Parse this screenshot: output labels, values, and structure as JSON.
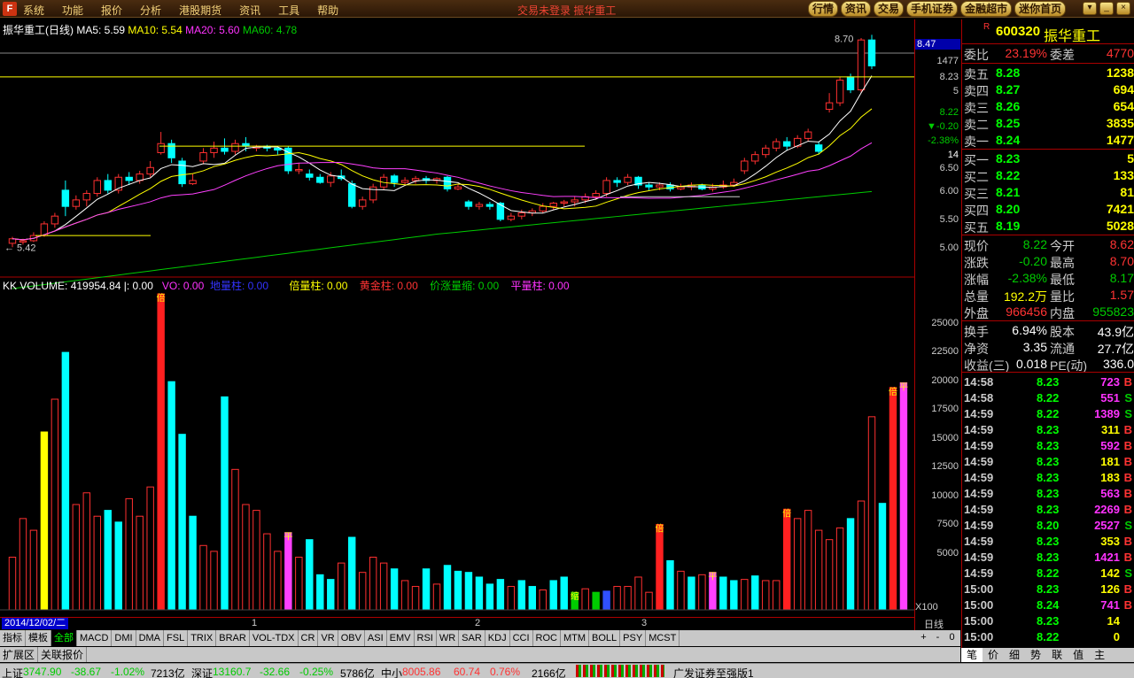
{
  "menu": {
    "items": [
      "系统",
      "功能",
      "报价",
      "分析",
      "港股期货",
      "资讯",
      "工具",
      "帮助"
    ],
    "center_title": "交易未登录    振华重工",
    "top_buttons": [
      "行情",
      "资讯",
      "交易",
      "手机证券",
      "金融超市",
      "迷你首页"
    ],
    "window_buttons": [
      "▾",
      "_",
      "×"
    ]
  },
  "chart": {
    "title": "振华重工(日线)",
    "ma5": "MA5: 5.59",
    "ma10": "MA10: 5.54",
    "ma20": "MA20: 5.60",
    "ma60": "MA60: 4.78",
    "high_label": "8.70",
    "low_label": "5.42",
    "price_axis": [
      "8.47",
      "1477",
      "8.23",
      "5",
      "8.22",
      "▼-0.20",
      "-2.38%",
      "14",
      "6.50",
      "6.00",
      "5.50",
      "5.00"
    ],
    "colors": {
      "up": "#ff3030",
      "down": "#00ffff",
      "ma5": "#ffffff",
      "ma10": "#ffff00",
      "ma20": "#ff40ff",
      "ma60": "#00cc00"
    }
  },
  "volume": {
    "header": {
      "name": "KK VOLUME: 419954.84",
      "sep": "|: 0.00",
      "vo": "VO: 0.00",
      "dl": "地量柱: 0.00",
      "bl": "倍量柱: 0.00",
      "hj": "黄金柱: 0.00",
      "jz": "价涨量缩: 0.00",
      "pl": "平量柱: 0.00"
    },
    "axis": [
      "25000",
      "22500",
      "20000",
      "17500",
      "15000",
      "12500",
      "10000",
      "7500",
      "5000",
      "X100"
    ],
    "marker_labels": {
      "bei": "倍",
      "ping": "平",
      "suo": "缩"
    }
  },
  "chart_data": {
    "type": "candlestick",
    "candles": [
      {
        "o": 5.48,
        "c": 5.55,
        "h": 5.58,
        "l": 5.42
      },
      {
        "o": 5.5,
        "c": 5.52,
        "h": 5.55,
        "l": 5.46
      },
      {
        "o": 5.52,
        "c": 5.6,
        "h": 5.65,
        "l": 5.5
      },
      {
        "o": 5.6,
        "c": 5.78,
        "h": 5.82,
        "l": 5.58
      },
      {
        "o": 5.78,
        "c": 5.9,
        "h": 5.95,
        "l": 5.72
      },
      {
        "o": 6.3,
        "c": 6.05,
        "h": 6.45,
        "l": 5.9
      },
      {
        "o": 6.05,
        "c": 6.15,
        "h": 6.22,
        "l": 6.0
      },
      {
        "o": 6.15,
        "c": 6.25,
        "h": 6.3,
        "l": 6.05
      },
      {
        "o": 6.25,
        "c": 6.45,
        "h": 6.5,
        "l": 6.2
      },
      {
        "o": 6.45,
        "c": 6.3,
        "h": 6.55,
        "l": 6.25
      },
      {
        "o": 6.3,
        "c": 6.5,
        "h": 6.55,
        "l": 6.25
      },
      {
        "o": 6.5,
        "c": 6.45,
        "h": 6.58,
        "l": 6.38
      },
      {
        "o": 6.45,
        "c": 6.55,
        "h": 6.6,
        "l": 6.4
      },
      {
        "o": 6.55,
        "c": 6.65,
        "h": 6.75,
        "l": 6.5
      },
      {
        "o": 6.88,
        "c": 7.02,
        "h": 7.2,
        "l": 6.85
      },
      {
        "o": 7.02,
        "c": 6.8,
        "h": 7.08,
        "l": 6.72
      },
      {
        "o": 6.75,
        "c": 6.4,
        "h": 6.8,
        "l": 6.35
      },
      {
        "o": 6.4,
        "c": 6.45,
        "h": 6.55,
        "l": 6.38
      },
      {
        "o": 6.75,
        "c": 6.88,
        "h": 6.95,
        "l": 6.7
      },
      {
        "o": 6.88,
        "c": 6.95,
        "h": 7.05,
        "l": 6.8
      },
      {
        "o": 6.95,
        "c": 6.9,
        "h": 7.1,
        "l": 6.85
      },
      {
        "o": 6.9,
        "c": 7.02,
        "h": 7.08,
        "l": 6.85
      },
      {
        "o": 7.02,
        "c": 6.98,
        "h": 7.12,
        "l": 6.9
      },
      {
        "o": 6.95,
        "c": 6.98,
        "h": 7.0,
        "l": 6.9
      },
      {
        "o": 6.98,
        "c": 6.95,
        "h": 7.0,
        "l": 6.9
      },
      {
        "o": 6.95,
        "c": 6.92,
        "h": 6.98,
        "l": 6.85
      },
      {
        "o": 6.95,
        "c": 6.6,
        "h": 6.98,
        "l": 6.55
      },
      {
        "o": 6.6,
        "c": 6.62,
        "h": 6.72,
        "l": 6.55
      },
      {
        "o": 6.55,
        "c": 6.5,
        "h": 6.62,
        "l": 6.45
      },
      {
        "o": 6.5,
        "c": 6.42,
        "h": 6.55,
        "l": 6.4
      },
      {
        "o": 6.42,
        "c": 6.52,
        "h": 6.58,
        "l": 6.35
      },
      {
        "o": 6.52,
        "c": 6.48,
        "h": 6.62,
        "l": 6.45
      },
      {
        "o": 6.4,
        "c": 6.05,
        "h": 6.45,
        "l": 6.02
      },
      {
        "o": 6.05,
        "c": 6.15,
        "h": 6.2,
        "l": 6.0
      },
      {
        "o": 6.15,
        "c": 6.35,
        "h": 6.4,
        "l": 6.1
      },
      {
        "o": 6.35,
        "c": 6.5,
        "h": 6.55,
        "l": 6.3
      },
      {
        "o": 6.52,
        "c": 6.42,
        "h": 6.55,
        "l": 6.35
      },
      {
        "o": 6.42,
        "c": 6.45,
        "h": 6.5,
        "l": 6.38
      },
      {
        "o": 6.45,
        "c": 6.48,
        "h": 6.52,
        "l": 6.4
      },
      {
        "o": 6.48,
        "c": 6.45,
        "h": 6.52,
        "l": 6.4
      },
      {
        "o": 6.45,
        "c": 6.48,
        "h": 6.5,
        "l": 6.4
      },
      {
        "o": 6.5,
        "c": 6.32,
        "h": 6.52,
        "l": 6.28
      },
      {
        "o": 6.32,
        "c": 6.35,
        "h": 6.4,
        "l": 6.3
      },
      {
        "o": 6.12,
        "c": 6.05,
        "h": 6.15,
        "l": 6.0
      },
      {
        "o": 6.05,
        "c": 6.08,
        "h": 6.12,
        "l": 6.0
      },
      {
        "o": 6.08,
        "c": 6.05,
        "h": 6.12,
        "l": 6.0
      },
      {
        "o": 6.1,
        "c": 5.85,
        "h": 6.12,
        "l": 5.82
      },
      {
        "o": 5.85,
        "c": 5.9,
        "h": 5.95,
        "l": 5.82
      },
      {
        "o": 5.9,
        "c": 5.95,
        "h": 6.0,
        "l": 5.85
      },
      {
        "o": 5.95,
        "c": 5.98,
        "h": 6.02,
        "l": 5.9
      },
      {
        "o": 5.98,
        "c": 6.05,
        "h": 6.1,
        "l": 5.95
      },
      {
        "o": 6.05,
        "c": 6.1,
        "h": 6.12,
        "l": 6.0
      },
      {
        "o": 6.1,
        "c": 6.12,
        "h": 6.15,
        "l": 6.05
      },
      {
        "o": 6.12,
        "c": 6.15,
        "h": 6.2,
        "l": 6.05
      },
      {
        "o": 6.15,
        "c": 6.2,
        "h": 6.25,
        "l": 6.1
      },
      {
        "o": 6.2,
        "c": 6.25,
        "h": 6.3,
        "l": 6.15
      },
      {
        "o": 6.25,
        "c": 6.45,
        "h": 6.5,
        "l": 6.2
      },
      {
        "o": 6.45,
        "c": 6.42,
        "h": 6.5,
        "l": 6.35
      },
      {
        "o": 6.42,
        "c": 6.5,
        "h": 6.55,
        "l": 6.38
      },
      {
        "o": 6.5,
        "c": 6.38,
        "h": 6.52,
        "l": 6.32
      },
      {
        "o": 6.38,
        "c": 6.35,
        "h": 6.42,
        "l": 6.3
      },
      {
        "o": 6.35,
        "c": 6.38,
        "h": 6.42,
        "l": 6.3
      },
      {
        "o": 6.38,
        "c": 6.32,
        "h": 6.42,
        "l": 6.28
      },
      {
        "o": 6.32,
        "c": 6.35,
        "h": 6.4,
        "l": 6.3
      },
      {
        "o": 6.35,
        "c": 6.38,
        "h": 6.42,
        "l": 6.3
      },
      {
        "o": 6.38,
        "c": 6.32,
        "h": 6.4,
        "l": 6.3
      },
      {
        "o": 6.32,
        "c": 6.35,
        "h": 6.4,
        "l": 6.28
      },
      {
        "o": 6.35,
        "c": 6.38,
        "h": 6.45,
        "l": 6.32
      },
      {
        "o": 6.38,
        "c": 6.42,
        "h": 6.48,
        "l": 6.35
      },
      {
        "o": 6.6,
        "c": 6.75,
        "h": 6.8,
        "l": 6.55
      },
      {
        "o": 6.75,
        "c": 6.85,
        "h": 6.9,
        "l": 6.7
      },
      {
        "o": 6.85,
        "c": 6.95,
        "h": 7.0,
        "l": 6.8
      },
      {
        "o": 6.95,
        "c": 7.05,
        "h": 7.1,
        "l": 6.9
      },
      {
        "o": 7.05,
        "c": 6.98,
        "h": 7.12,
        "l": 6.92
      },
      {
        "o": 6.98,
        "c": 7.1,
        "h": 7.15,
        "l": 6.95
      },
      {
        "o": 7.1,
        "c": 7.2,
        "h": 7.25,
        "l": 7.05
      },
      {
        "o": 7.0,
        "c": 6.9,
        "h": 7.05,
        "l": 6.85
      },
      {
        "o": 7.55,
        "c": 7.65,
        "h": 7.8,
        "l": 7.5
      },
      {
        "o": 7.65,
        "c": 8.0,
        "h": 8.05,
        "l": 7.6
      },
      {
        "o": 8.05,
        "c": 7.85,
        "h": 8.1,
        "l": 7.8
      },
      {
        "o": 7.85,
        "c": 8.62,
        "h": 8.65,
        "l": 7.8
      },
      {
        "o": 8.62,
        "c": 8.22,
        "h": 8.7,
        "l": 8.17
      }
    ],
    "volumes": [
      {
        "v": 4500,
        "t": "up"
      },
      {
        "v": 7800,
        "t": "up"
      },
      {
        "v": 6800,
        "t": "up"
      },
      {
        "v": 15200,
        "t": "yel"
      },
      {
        "v": 18000,
        "t": "up"
      },
      {
        "v": 22000,
        "t": "down"
      },
      {
        "v": 9000,
        "t": "up"
      },
      {
        "v": 10000,
        "t": "up"
      },
      {
        "v": 8000,
        "t": "up"
      },
      {
        "v": 8500,
        "t": "down"
      },
      {
        "v": 7500,
        "t": "down"
      },
      {
        "v": 9500,
        "t": "up"
      },
      {
        "v": 8000,
        "t": "up"
      },
      {
        "v": 10500,
        "t": "up"
      },
      {
        "v": 27000,
        "t": "bei"
      },
      {
        "v": 19500,
        "t": "down"
      },
      {
        "v": 15000,
        "t": "down"
      },
      {
        "v": 8000,
        "t": "down"
      },
      {
        "v": 5500,
        "t": "up"
      },
      {
        "v": 5000,
        "t": "up"
      },
      {
        "v": 18200,
        "t": "down"
      },
      {
        "v": 12000,
        "t": "up"
      },
      {
        "v": 9000,
        "t": "up"
      },
      {
        "v": 8500,
        "t": "up"
      },
      {
        "v": 6500,
        "t": "up"
      },
      {
        "v": 5000,
        "t": "up"
      },
      {
        "v": 6600,
        "t": "ping"
      },
      {
        "v": 4500,
        "t": "up"
      },
      {
        "v": 6000,
        "t": "down"
      },
      {
        "v": 3000,
        "t": "down"
      },
      {
        "v": 2600,
        "t": "down"
      },
      {
        "v": 4000,
        "t": "up"
      },
      {
        "v": 6200,
        "t": "down"
      },
      {
        "v": 3200,
        "t": "up"
      },
      {
        "v": 4500,
        "t": "up"
      },
      {
        "v": 4000,
        "t": "up"
      },
      {
        "v": 3500,
        "t": "down"
      },
      {
        "v": 2500,
        "t": "up"
      },
      {
        "v": 2000,
        "t": "up"
      },
      {
        "v": 3500,
        "t": "down"
      },
      {
        "v": 2200,
        "t": "up"
      },
      {
        "v": 3800,
        "t": "down"
      },
      {
        "v": 3300,
        "t": "down"
      },
      {
        "v": 3200,
        "t": "down"
      },
      {
        "v": 2800,
        "t": "down"
      },
      {
        "v": 2200,
        "t": "down"
      },
      {
        "v": 2600,
        "t": "down"
      },
      {
        "v": 2000,
        "t": "up"
      },
      {
        "v": 2500,
        "t": "down"
      },
      {
        "v": 2000,
        "t": "down"
      },
      {
        "v": 1700,
        "t": "up"
      },
      {
        "v": 2500,
        "t": "down"
      },
      {
        "v": 2800,
        "t": "down"
      },
      {
        "v": 1500,
        "t": "suo"
      },
      {
        "v": 1800,
        "t": "up"
      },
      {
        "v": 1500,
        "t": "green2"
      },
      {
        "v": 1600,
        "t": "blue2"
      },
      {
        "v": 2000,
        "t": "up"
      },
      {
        "v": 2000,
        "t": "up"
      },
      {
        "v": 2800,
        "t": "up"
      },
      {
        "v": 1500,
        "t": "up"
      },
      {
        "v": 7300,
        "t": "bei"
      },
      {
        "v": 4200,
        "t": "down"
      },
      {
        "v": 3300,
        "t": "up"
      },
      {
        "v": 2800,
        "t": "down"
      },
      {
        "v": 3000,
        "t": "up"
      },
      {
        "v": 3200,
        "t": "ping"
      },
      {
        "v": 2800,
        "t": "down"
      },
      {
        "v": 2500,
        "t": "down"
      },
      {
        "v": 2600,
        "t": "up"
      },
      {
        "v": 2900,
        "t": "down"
      },
      {
        "v": 2500,
        "t": "up"
      },
      {
        "v": 2500,
        "t": "up"
      },
      {
        "v": 8600,
        "t": "bei"
      },
      {
        "v": 7800,
        "t": "up"
      },
      {
        "v": 8500,
        "t": "up"
      },
      {
        "v": 6800,
        "t": "up"
      },
      {
        "v": 6000,
        "t": "up"
      },
      {
        "v": 7000,
        "t": "up"
      },
      {
        "v": 7800,
        "t": "down"
      },
      {
        "v": 9300,
        "t": "up"
      },
      {
        "v": 16500,
        "t": "up"
      },
      {
        "v": 9100,
        "t": "down"
      },
      {
        "v": 19000,
        "t": "bei"
      },
      {
        "v": 19400,
        "t": "ping"
      }
    ],
    "ylim": [
      5.0,
      8.8
    ],
    "vol_ylim": [
      0,
      27000
    ]
  },
  "dates": {
    "start": "2014/12/02/二",
    "marks": [
      "1",
      "2",
      "3"
    ],
    "right": "日线"
  },
  "indicator_tabs": [
    "指标",
    "模板",
    "全部",
    "MACD",
    "DMI",
    "DMA",
    "FSL",
    "TRIX",
    "BRAR",
    "VOL-TDX",
    "CR",
    "VR",
    "OBV",
    "ASI",
    "EMV",
    "RSI",
    "WR",
    "SAR",
    "KDJ",
    "CCI",
    "ROC",
    "MTM",
    "BOLL",
    "PSY",
    "MCST"
  ],
  "bottom_tabs": [
    "扩展区",
    "关联报价"
  ],
  "zoom": [
    "+",
    "-",
    "0"
  ],
  "quote": {
    "code": "600320",
    "name": "振华重工",
    "rflag": "R",
    "weibi_label": "委比",
    "weibi": "23.19%",
    "weicha_label": "委差",
    "weicha": "4770",
    "asks": [
      {
        "label": "卖五",
        "price": "8.28",
        "vol": "1238"
      },
      {
        "label": "卖四",
        "price": "8.27",
        "vol": "694"
      },
      {
        "label": "卖三",
        "price": "8.26",
        "vol": "654"
      },
      {
        "label": "卖二",
        "price": "8.25",
        "vol": "3835"
      },
      {
        "label": "卖一",
        "price": "8.24",
        "vol": "1477"
      }
    ],
    "bids": [
      {
        "label": "买一",
        "price": "8.23",
        "vol": "5"
      },
      {
        "label": "买二",
        "price": "8.22",
        "vol": "133"
      },
      {
        "label": "买三",
        "price": "8.21",
        "vol": "81"
      },
      {
        "label": "买四",
        "price": "8.20",
        "vol": "7421"
      },
      {
        "label": "买五",
        "price": "8.19",
        "vol": "5028"
      }
    ],
    "stats": [
      {
        "l1": "现价",
        "v1": "8.22",
        "c1": "grn",
        "l2": "今开",
        "v2": "8.62",
        "c2": "red"
      },
      {
        "l1": "涨跌",
        "v1": "-0.20",
        "c1": "grn",
        "l2": "最高",
        "v2": "8.70",
        "c2": "red"
      },
      {
        "l1": "涨幅",
        "v1": "-2.38%",
        "c1": "grn",
        "l2": "最低",
        "v2": "8.17",
        "c2": "grn"
      },
      {
        "l1": "总量",
        "v1": "192.2万",
        "c1": "yel",
        "l2": "量比",
        "v2": "1.57",
        "c2": "red"
      },
      {
        "l1": "外盘",
        "v1": "966456",
        "c1": "red",
        "l2": "内盘",
        "v2": "955823",
        "c2": "grn"
      }
    ],
    "stats2": [
      {
        "l1": "换手",
        "v1": "6.94%",
        "l2": "股本",
        "v2": "43.9亿"
      },
      {
        "l1": "净资",
        "v1": "3.35",
        "l2": "流通",
        "v2": "27.7亿"
      },
      {
        "l1": "收益(三)",
        "v1": "0.018",
        "l2": "PE(动)",
        "v2": "336.0"
      }
    ],
    "ticks": [
      {
        "t": "14:58",
        "p": "8.23",
        "q": "723",
        "c": "mag",
        "b": "B"
      },
      {
        "t": "14:58",
        "p": "8.22",
        "q": "551",
        "c": "mag",
        "b": "S"
      },
      {
        "t": "14:59",
        "p": "8.22",
        "q": "1389",
        "c": "mag",
        "b": "S"
      },
      {
        "t": "14:59",
        "p": "8.23",
        "q": "311",
        "c": "yel",
        "b": "B"
      },
      {
        "t": "14:59",
        "p": "8.23",
        "q": "592",
        "c": "mag",
        "b": "B"
      },
      {
        "t": "14:59",
        "p": "8.23",
        "q": "181",
        "c": "yel",
        "b": "B"
      },
      {
        "t": "14:59",
        "p": "8.23",
        "q": "183",
        "c": "yel",
        "b": "B"
      },
      {
        "t": "14:59",
        "p": "8.23",
        "q": "563",
        "c": "mag",
        "b": "B"
      },
      {
        "t": "14:59",
        "p": "8.23",
        "q": "2269",
        "c": "mag",
        "b": "B"
      },
      {
        "t": "14:59",
        "p": "8.20",
        "q": "2527",
        "c": "mag",
        "b": "S"
      },
      {
        "t": "14:59",
        "p": "8.23",
        "q": "353",
        "c": "yel",
        "b": "B"
      },
      {
        "t": "14:59",
        "p": "8.23",
        "q": "1421",
        "c": "mag",
        "b": "B"
      },
      {
        "t": "14:59",
        "p": "8.22",
        "q": "142",
        "c": "yel",
        "b": "S"
      },
      {
        "t": "15:00",
        "p": "8.23",
        "q": "126",
        "c": "yel",
        "b": "B"
      },
      {
        "t": "15:00",
        "p": "8.24",
        "q": "741",
        "c": "mag",
        "b": "B"
      },
      {
        "t": "15:00",
        "p": "8.23",
        "q": "14",
        "c": "yel",
        "b": ""
      },
      {
        "t": "15:00",
        "p": "8.22",
        "q": "0",
        "c": "yel",
        "b": ""
      }
    ],
    "tabs": [
      "笔",
      "价",
      "细",
      "势",
      "联",
      "值",
      "主"
    ]
  },
  "status": {
    "sh_label": "上证",
    "sh_val": "3747.90",
    "sh_chg": "-38.67",
    "sh_pct": "-1.02%",
    "sh_amt": "7213亿",
    "sz_label": "深证",
    "sz_val": "13160.7",
    "sz_chg": "-32.66",
    "sz_pct": "-0.25%",
    "sz_amt": "5786亿",
    "zx_label": "中小",
    "zx_val": "8005.86",
    "zx_chg": "60.74",
    "zx_pct": "0.76%",
    "zx_amt": "2166亿",
    "broker": "广发证券至强版1"
  }
}
